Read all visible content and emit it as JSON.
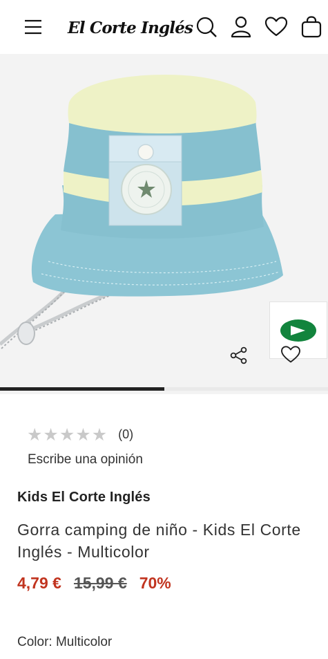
{
  "header": {
    "logo_text": "El Corte Inglés",
    "icons": [
      "menu-icon",
      "search-icon",
      "user-icon",
      "heart-icon",
      "bag-icon"
    ]
  },
  "gallery": {
    "progress": 0.5,
    "play_icon": "play-icon",
    "colors": {
      "hat_blue": "#8cc5d4",
      "hat_yellow": "#eef2c6",
      "play_green": "#12843d"
    }
  },
  "rating": {
    "stars_filled": 0,
    "stars_total": 5,
    "count": "(0)",
    "write_review": "Escribe una opinión"
  },
  "product": {
    "brand": "Kids El Corte Inglés",
    "title": "Gorra camping de niño - Kids El Corte Inglés - Multicolor",
    "price_now": "4,79 €",
    "price_old": "15,99 €",
    "discount": "70%",
    "color_label": "Color: Multicolor"
  },
  "theme": {
    "sale_red": "#c1341f",
    "text": "#333333"
  }
}
